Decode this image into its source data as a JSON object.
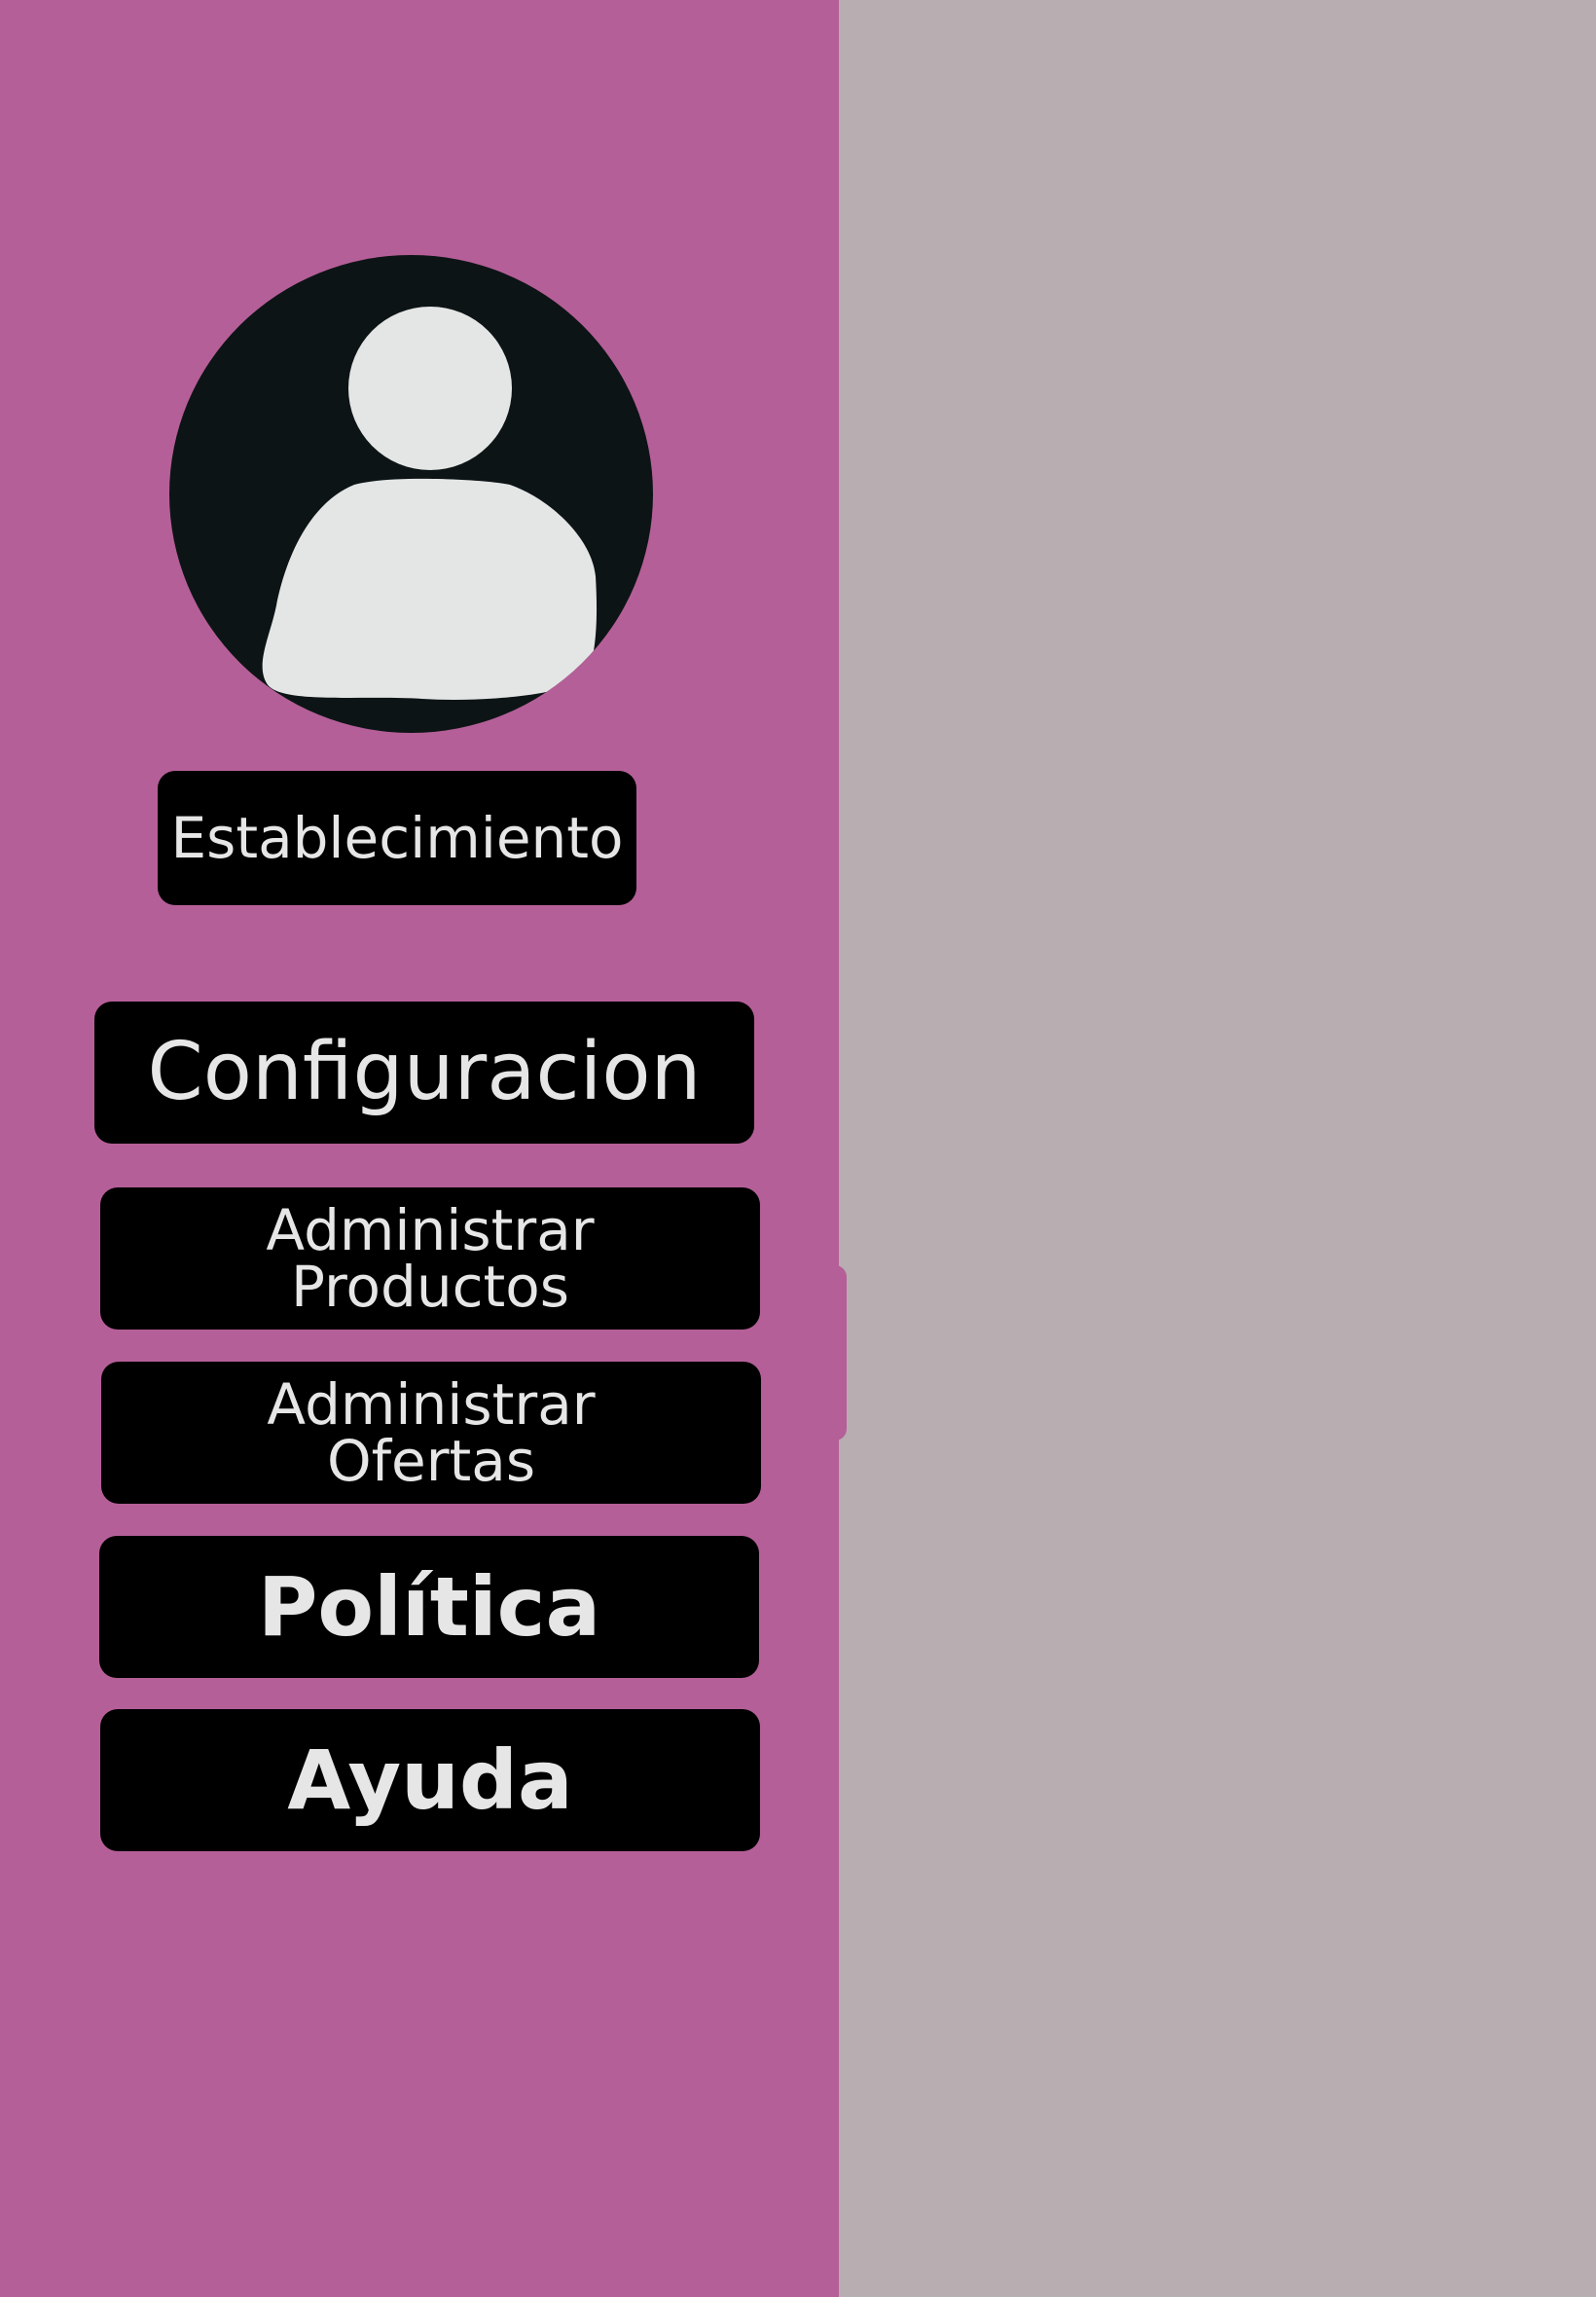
{
  "colors": {
    "sidebar": "#b55f98",
    "content": "#b8aeb2",
    "button": "#000000",
    "button_text": "#e6e6e6",
    "avatar": "#0d1416"
  },
  "profile": {
    "icon": "user-icon",
    "name": "Establecimiento"
  },
  "menu": {
    "configuracion": "Configuracion",
    "productos_line1": "Administrar",
    "productos_line2": "Productos",
    "ofertas_line1": "Administrar",
    "ofertas_line2": "Ofertas",
    "politica": "Política",
    "ayuda": "Ayuda"
  }
}
